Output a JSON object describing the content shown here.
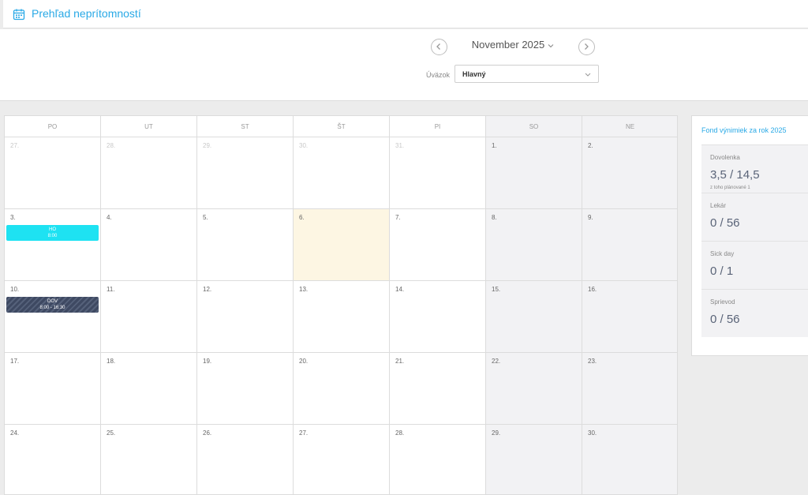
{
  "header": {
    "title": "Prehľad neprítomností",
    "icon": "calendar-icon",
    "accent": "#29a9e6"
  },
  "filters": {
    "month_label": "November 2025",
    "uvazok_label": "Úväzok",
    "uvazok_value": "Hlavný"
  },
  "calendar": {
    "weekdays": [
      "PO",
      "UT",
      "ST",
      "ŠT",
      "PI",
      "SO",
      "NE"
    ],
    "days": [
      {
        "n": "27.",
        "other": true
      },
      {
        "n": "28.",
        "other": true
      },
      {
        "n": "29.",
        "other": true
      },
      {
        "n": "30.",
        "other": true
      },
      {
        "n": "31.",
        "other": true
      },
      {
        "n": "1.",
        "weekend": true
      },
      {
        "n": "2.",
        "weekend": true
      },
      {
        "n": "3.",
        "event": {
          "type": "ho",
          "label": "HO",
          "time": "8:00"
        }
      },
      {
        "n": "4."
      },
      {
        "n": "5."
      },
      {
        "n": "6.",
        "today": true
      },
      {
        "n": "7."
      },
      {
        "n": "8.",
        "weekend": true
      },
      {
        "n": "9.",
        "weekend": true
      },
      {
        "n": "10.",
        "event": {
          "type": "dov",
          "label": "DOV",
          "time": "8:00 - 16:30"
        }
      },
      {
        "n": "11."
      },
      {
        "n": "12."
      },
      {
        "n": "13."
      },
      {
        "n": "14."
      },
      {
        "n": "15.",
        "weekend": true
      },
      {
        "n": "16.",
        "weekend": true
      },
      {
        "n": "17."
      },
      {
        "n": "18."
      },
      {
        "n": "19."
      },
      {
        "n": "20."
      },
      {
        "n": "21."
      },
      {
        "n": "22.",
        "weekend": true
      },
      {
        "n": "23.",
        "weekend": true
      },
      {
        "n": "24."
      },
      {
        "n": "25."
      },
      {
        "n": "26."
      },
      {
        "n": "27."
      },
      {
        "n": "28."
      },
      {
        "n": "29.",
        "weekend": true
      },
      {
        "n": "30.",
        "weekend": true
      }
    ],
    "colors": {
      "ho": "#1ee2f2",
      "dov": "#3e4962",
      "today": "#fdf6e3",
      "weekend": "#f2f2f4"
    }
  },
  "funds": {
    "title": "Fond výnimiek za rok 2025",
    "items": [
      {
        "name": "Dovolenka",
        "value": "3,5 / 14,5",
        "sub": "z toho plánované 1"
      },
      {
        "name": "Lekár",
        "value": "0 / 56"
      },
      {
        "name": "Sick day",
        "value": "0 / 1"
      },
      {
        "name": "Sprievod",
        "value": "0 / 56"
      }
    ]
  }
}
